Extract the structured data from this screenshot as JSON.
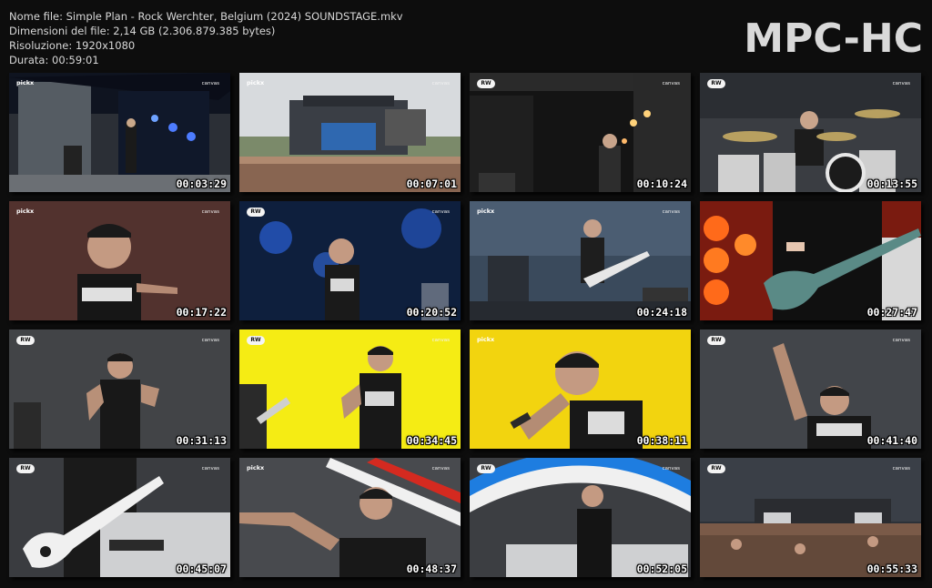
{
  "file_info": {
    "name_line": "Nome file: Simple Plan - Rock Werchter, Belgium (2024) SOUNDSTAGE.mkv",
    "size_line": "Dimensioni del file: 2,14 GB (2.306.879.385 bytes)",
    "resolution_line": "Risoluzione: 1920x1080",
    "duration_line": "Durata: 00:59:01"
  },
  "brand": "MPC-HC",
  "thumbnails": [
    {
      "timestamp": "00:03:29",
      "scene": "stage-wide-night"
    },
    {
      "timestamp": "00:07:01",
      "scene": "crowd-stage-overcast"
    },
    {
      "timestamp": "00:10:24",
      "scene": "dark-stage-singer"
    },
    {
      "timestamp": "00:13:55",
      "scene": "drummer"
    },
    {
      "timestamp": "00:17:22",
      "scene": "singer-pointing-closeup"
    },
    {
      "timestamp": "00:20:52",
      "scene": "singer-blue-lights"
    },
    {
      "timestamp": "00:24:18",
      "scene": "guitarist-stage"
    },
    {
      "timestamp": "00:27:47",
      "scene": "guitar-closeup-red"
    },
    {
      "timestamp": "00:31:13",
      "scene": "singer-mic"
    },
    {
      "timestamp": "00:34:45",
      "scene": "singer-yellow"
    },
    {
      "timestamp": "00:38:11",
      "scene": "singer-yellow-closeup"
    },
    {
      "timestamp": "00:41:40",
      "scene": "singer-arm-raised"
    },
    {
      "timestamp": "00:45:07",
      "scene": "guitar-white-amp"
    },
    {
      "timestamp": "00:48:37",
      "scene": "singer-pointing-stripes"
    },
    {
      "timestamp": "00:52:05",
      "scene": "singer-blue-arc"
    },
    {
      "timestamp": "00:55:33",
      "scene": "wide-crowd-day"
    }
  ],
  "overlay_text": {
    "broadcaster_a": "pickx",
    "broadcaster_b": "RW",
    "broadcaster_c": "canvas"
  }
}
